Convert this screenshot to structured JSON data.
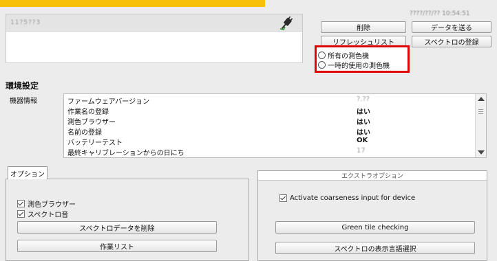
{
  "device": {
    "id": "11?5??3",
    "datetime": "????/??/?? 10:54:51"
  },
  "buttons": {
    "delete": "削除",
    "send_data": "データを送る",
    "refresh_list": "リフレッシュリスト",
    "register_spectrum": "スペクトロの登録"
  },
  "radio": {
    "options": [
      "所有の測色機",
      "一時的使用の測色機"
    ]
  },
  "settings": {
    "title": "環境設定",
    "device_info_label": "機器情報",
    "rows": [
      {
        "key": "ファームウェアバージョン",
        "value": "?.??"
      },
      {
        "key": "作業名の登録",
        "value": "はい"
      },
      {
        "key": "測色ブラウザー",
        "value": "はい"
      },
      {
        "key": "名前の登録",
        "value": "はい"
      },
      {
        "key": "バッテリーテスト",
        "value": "OK"
      },
      {
        "key": "最終キャリブレーションからの日にち",
        "value": "17"
      }
    ]
  },
  "options": {
    "tab_label": "オプション",
    "checkboxes": [
      "測色ブラウザー",
      "スペクトロ音"
    ],
    "delete_spectro_data": "スペクトロデータを削除",
    "work_list": "作業リスト"
  },
  "extra": {
    "title": "エクストラオプション",
    "checkbox": "Activate coarseness input for device",
    "green_tile": "Green tile checking",
    "display_language": "スペクトロの表示言語選択"
  },
  "colors": {
    "accent_bar": "#f8c008",
    "highlight": "#e00000"
  }
}
